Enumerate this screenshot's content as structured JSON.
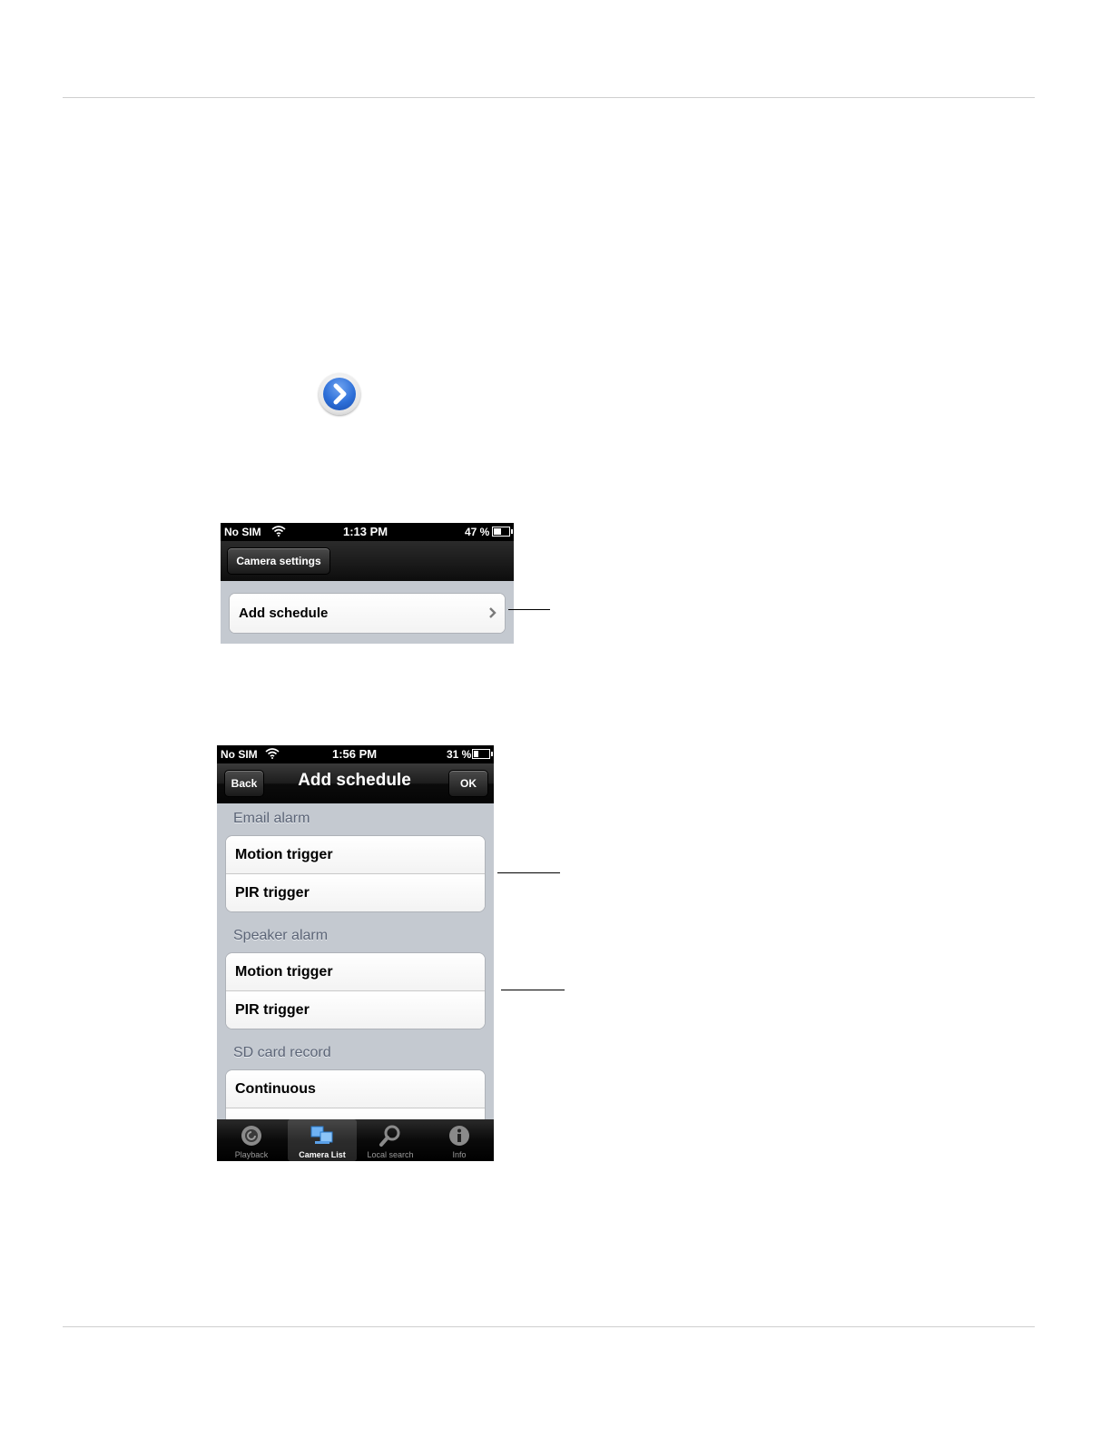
{
  "screen1": {
    "status": {
      "carrier": "No SIM",
      "time": "1:13 PM",
      "battery": "47 %",
      "battery_level": 0.47
    },
    "nav": {
      "back_label": "Camera settings"
    },
    "row_label": "Add schedule"
  },
  "screen2": {
    "status": {
      "carrier": "No SIM",
      "time": "1:56 PM",
      "battery": "31 %",
      "battery_level": 0.31
    },
    "nav": {
      "back_label": "Back",
      "title": "Add schedule",
      "ok_label": "OK"
    },
    "sections": [
      {
        "label": "Email alarm",
        "rows": [
          "Motion trigger",
          "PIR trigger"
        ]
      },
      {
        "label": "Speaker alarm",
        "rows": [
          "Motion trigger",
          "PIR trigger"
        ]
      },
      {
        "label": "SD card record",
        "rows": [
          "Continuous"
        ]
      }
    ],
    "tabs": [
      {
        "label": "Playback",
        "icon": "playback-icon",
        "active": false
      },
      {
        "label": "Camera List",
        "icon": "camera-list-icon",
        "active": true
      },
      {
        "label": "Local search",
        "icon": "search-icon",
        "active": false
      },
      {
        "label": "Info",
        "icon": "info-icon",
        "active": false
      }
    ]
  },
  "colors": {
    "accent_blue": "#2d6fd8",
    "group_bg": "#c4c9d0",
    "section_text": "#5c6577"
  }
}
